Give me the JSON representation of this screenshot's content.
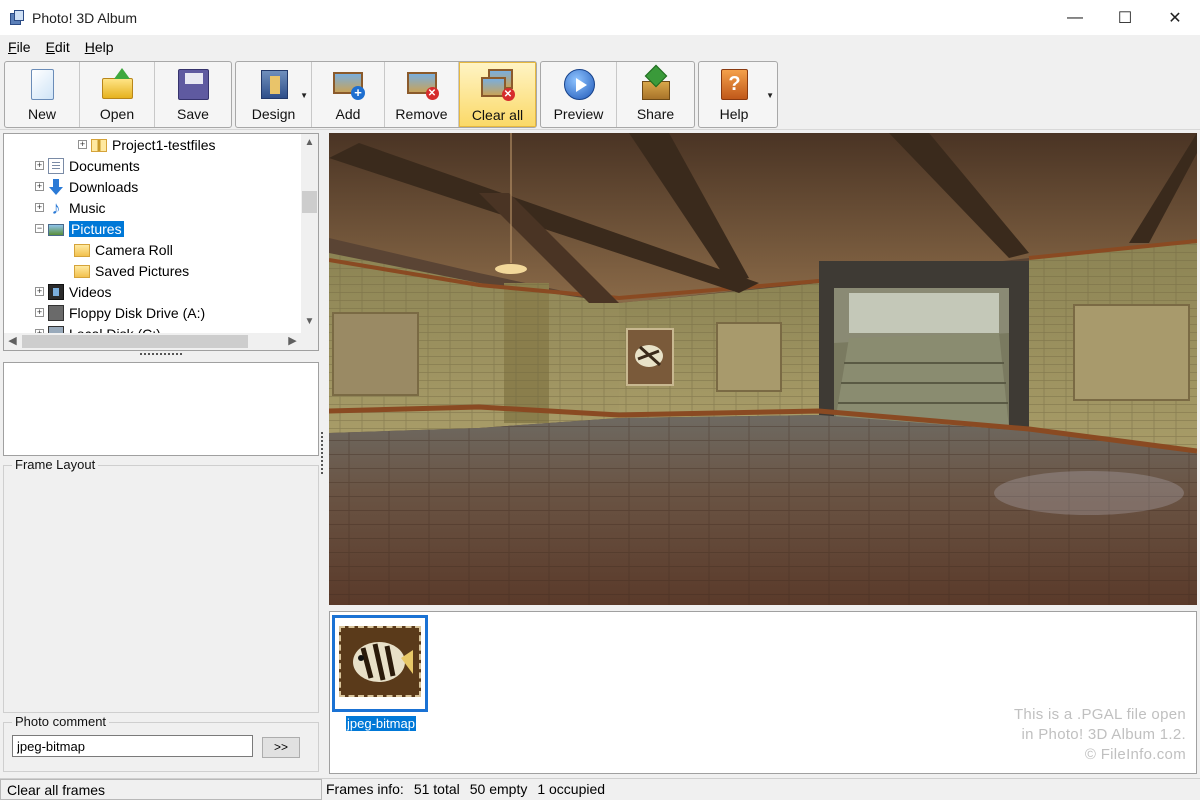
{
  "window": {
    "title": "Photo! 3D Album",
    "minimize": "—",
    "maximize": "☐",
    "close": "✕"
  },
  "menu": [
    "File",
    "Edit",
    "Help"
  ],
  "toolbar": {
    "new": "New",
    "open": "Open",
    "save": "Save",
    "design": "Design",
    "add": "Add",
    "remove": "Remove",
    "clear_all": "Clear all",
    "preview": "Preview",
    "share": "Share",
    "help": "Help"
  },
  "tree": {
    "items": [
      {
        "label": "Project1-testfiles",
        "icon": "zip-folder-icon"
      },
      {
        "label": "Documents",
        "icon": "documents-icon"
      },
      {
        "label": "Downloads",
        "icon": "downloads-icon"
      },
      {
        "label": "Music",
        "icon": "music-icon"
      },
      {
        "label": "Pictures",
        "icon": "pictures-icon",
        "selected": true
      },
      {
        "label": "Camera Roll",
        "icon": "folder-icon"
      },
      {
        "label": "Saved Pictures",
        "icon": "folder-icon"
      },
      {
        "label": "Videos",
        "icon": "videos-icon"
      },
      {
        "label": "Floppy Disk Drive (A:)",
        "icon": "floppy-icon"
      },
      {
        "label": "Local Disk (C:)",
        "icon": "disk-icon"
      }
    ]
  },
  "frame_layout": {
    "title": "Frame Layout"
  },
  "photo_comment": {
    "title": "Photo comment",
    "value": "jpeg-bitmap",
    "button": ">>"
  },
  "thumbnails": [
    {
      "caption": "jpeg-bitmap"
    }
  ],
  "watermark": [
    "This is a .PGAL file open",
    "in Photo! 3D Album 1.2.",
    "© FileInfo.com"
  ],
  "status": {
    "left": "Clear all frames",
    "frames_label": "Frames info:",
    "total": "51 total",
    "empty": "50 empty",
    "occupied": "1 occupied"
  }
}
